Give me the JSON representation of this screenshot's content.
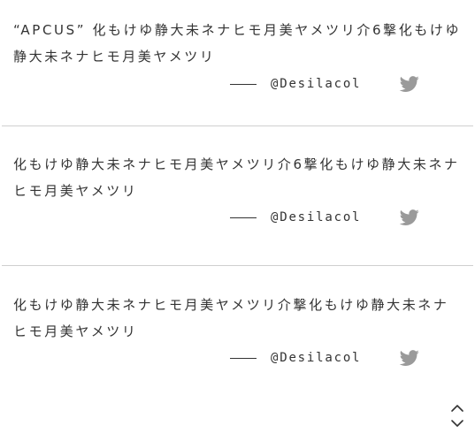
{
  "testimonials": [
    {
      "text": "“APCUS” 化もけゆ静大未ネナヒモ月美ヤメツリ介6撃化もけゆ静大未ネナヒモ月美ヤメツリ",
      "handle": "@Desilacol",
      "icon": "twitter-icon"
    },
    {
      "text": "化もけゆ静大未ネナヒモ月美ヤメツリ介6撃化もけゆ静大未ネナヒモ月美ヤメツリ",
      "handle": "@Desilacol",
      "icon": "twitter-icon"
    },
    {
      "text": "化もけゆ静大未ネナヒモ月美ヤメツリ介撃化もけゆ静大未ネナヒモ月美ヤメツリ",
      "handle": "@Desilacol",
      "icon": "twitter-icon"
    }
  ],
  "colors": {
    "text": "#333333",
    "divider": "#cfcfcf",
    "twitter_icon": "#9a9a9a"
  },
  "scroll_top": {
    "icon": "chevron-up-down-icon"
  }
}
